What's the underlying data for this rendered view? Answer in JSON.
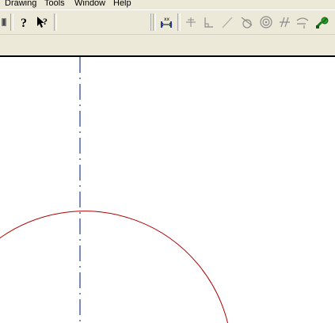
{
  "menubar": {
    "items": [
      "Drawing",
      "Tools",
      "Window",
      "Help"
    ]
  },
  "toolbar": {
    "left_icons": [
      "scroll-arrow-icon",
      "help-icon",
      "whats-this-help-icon"
    ],
    "right_icons": [
      "dimension-icon",
      "cross-constraint-icon",
      "perpendicular-constraint-icon",
      "line-constraint-icon",
      "tangent-constraint-icon",
      "concentric-constraint-icon",
      "parallel-constraint-icon",
      "arc-constraint-icon",
      "green-link-icon"
    ]
  },
  "colors": {
    "chrome": "#ece9d8",
    "centerline": "#1f3f7f",
    "circle": "#b00000",
    "canvas": "#ffffff"
  },
  "drawing": {
    "entities": [
      "vertical-centerline",
      "circle-arc"
    ]
  }
}
